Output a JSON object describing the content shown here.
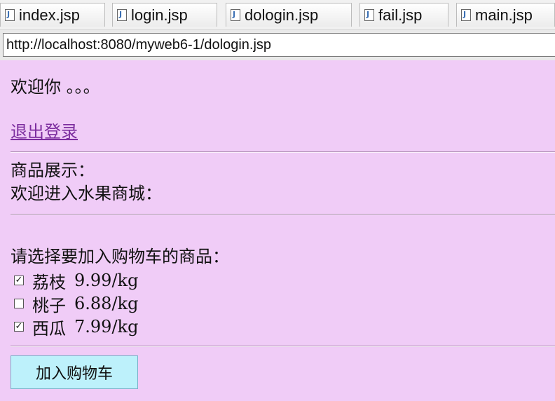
{
  "tabs": [
    {
      "label": "index.jsp"
    },
    {
      "label": "login.jsp"
    },
    {
      "label": "dologin.jsp"
    },
    {
      "label": "fail.jsp"
    },
    {
      "label": "main.jsp"
    }
  ],
  "address": {
    "url": "http://localhost:8080/myweb6-1/dologin.jsp"
  },
  "page": {
    "welcome": "欢迎你 。。。",
    "logout_link": "退出登录",
    "products_heading": "商品展示：",
    "store_welcome": "欢迎进入水果商城：",
    "select_prompt": "请选择要加入购物车的商品：",
    "products": [
      {
        "name": "荔枝",
        "price": "9.99/kg",
        "checked": true
      },
      {
        "name": "桃子",
        "price": "6.88/kg",
        "checked": false
      },
      {
        "name": "西瓜",
        "price": "7.99/kg",
        "checked": true
      }
    ],
    "add_to_cart": "加入购物车"
  },
  "colors": {
    "page_background": "#f0ccf7",
    "button_background": "#bdf1fb",
    "link": "#7b2c9e"
  }
}
